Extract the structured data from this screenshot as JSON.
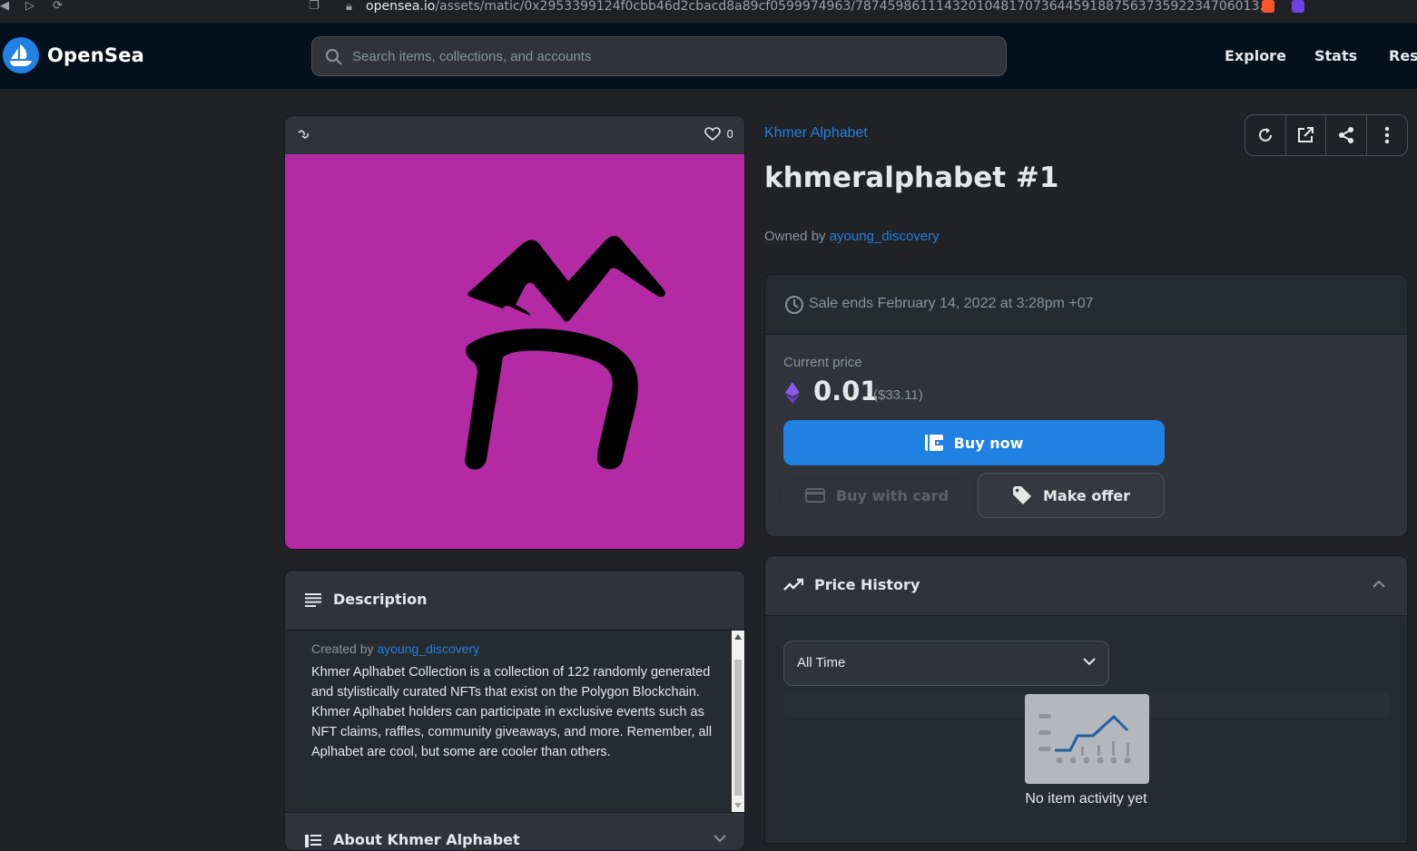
{
  "browser": {
    "url_host": "opensea.io",
    "url_path": "/assets/matic/0x2953399124f0cbb46d2cbacd8a89cf0599974963/78745986111432010481707364459188756373592234706013..."
  },
  "nav": {
    "brand": "OpenSea",
    "search_placeholder": "Search items, collections, and accounts",
    "links": [
      "Explore",
      "Stats",
      "Reso"
    ]
  },
  "asset": {
    "favorites_count": "0",
    "collection": "Khmer Alphabet",
    "name": "khmeralphabet #1",
    "owned_by_label": "Owned by",
    "owner": "ayoung_discovery",
    "art_background": "#b429a4"
  },
  "description": {
    "title": "Description",
    "created_by_label": "Created by",
    "creator": "ayoung_discovery",
    "text": "Khmer Aplhabet Collection is a collection of 122 randomly generated and stylistically curated NFTs that exist on the Polygon Blockchain. Khmer Aplhabet holders can participate in exclusive events such as NFT claims, raffles, community giveaways, and more. Remember, all Aplhabet are cool, but some are cooler than others.",
    "about_title": "About Khmer Alphabet"
  },
  "sale": {
    "ends": "Sale ends February 14, 2022 at 3:28pm +07",
    "current_price_label": "Current price",
    "price": "0.01",
    "usd": "($33.11)",
    "buy_now": "Buy now",
    "buy_with_card": "Buy with card",
    "make_offer": "Make offer"
  },
  "price_history": {
    "title": "Price History",
    "range": "All Time",
    "empty": "No item activity yet"
  },
  "colors": {
    "accent": "#2081e2",
    "nav_bg": "#04111d",
    "page_bg": "#202225"
  }
}
